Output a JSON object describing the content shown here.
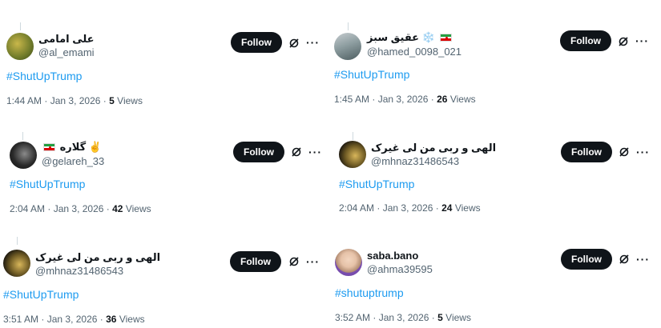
{
  "tweets": [
    {
      "name": "علی امامی",
      "handle": "@al_emami",
      "hashtag": "#ShutUpTrump",
      "time": "1:44 AM",
      "date": "Jan 3, 2026",
      "views_count": "5",
      "views_label": "Views",
      "follow_label": "Follow",
      "avatar_colors": [
        "#8a7b3a",
        "#c9b74a"
      ]
    },
    {
      "name": "عقیق سبز",
      "name_emoji": "❄️",
      "handle": "@hamed_0098_021",
      "hashtag": "#ShutUpTrump",
      "time": "1:45 AM",
      "date": "Jan 3, 2026",
      "views_count": "26",
      "views_label": "Views",
      "follow_label": "Follow",
      "avatar_colors": [
        "#9aa6a8",
        "#5b6e70"
      ]
    },
    {
      "name": "گلاره",
      "name_emoji": "✌️",
      "handle": "@gelareh_33",
      "hashtag": "#ShutUpTrump",
      "time": "2:04 AM",
      "date": "Jan 3, 2026",
      "views_count": "42",
      "views_label": "Views",
      "follow_label": "Follow",
      "avatar_colors": [
        "#1a1a1a",
        "#6b6b6b"
      ]
    },
    {
      "name": "الهی و ربی من لی غیرک",
      "handle": "@mhnaz31486543",
      "hashtag": "#ShutUpTrump",
      "time": "2:04 AM",
      "date": "Jan 3, 2026",
      "views_count": "24",
      "views_label": "Views",
      "follow_label": "Follow",
      "avatar_colors": [
        "#2a2416",
        "#b49a3a"
      ]
    },
    {
      "name": "الهی و ربی من لی غیرک",
      "handle": "@mhnaz31486543",
      "hashtag": "#ShutUpTrump",
      "time": "3:51 AM",
      "date": "Jan 3, 2026",
      "views_count": "36",
      "views_label": "Views",
      "follow_label": "Follow",
      "avatar_colors": [
        "#2a2416",
        "#b49a3a"
      ]
    },
    {
      "name": "saba.bano",
      "handle": "@ahma39595",
      "hashtag": "#shutuptrump",
      "time": "3:52 AM",
      "date": "Jan 3, 2026",
      "views_count": "5",
      "views_label": "Views",
      "follow_label": "Follow",
      "avatar_colors": [
        "#e6c2a8",
        "#7a4fb0"
      ]
    }
  ],
  "separators": {
    "dot": "·"
  },
  "icons": {
    "grok": "grok-icon",
    "more": "more-options-icon",
    "flag": "iran-flag-icon"
  },
  "colors": {
    "follow_bg": "#0f1419",
    "hashtag": "#1d9bf0",
    "secondary_text": "#536471"
  }
}
